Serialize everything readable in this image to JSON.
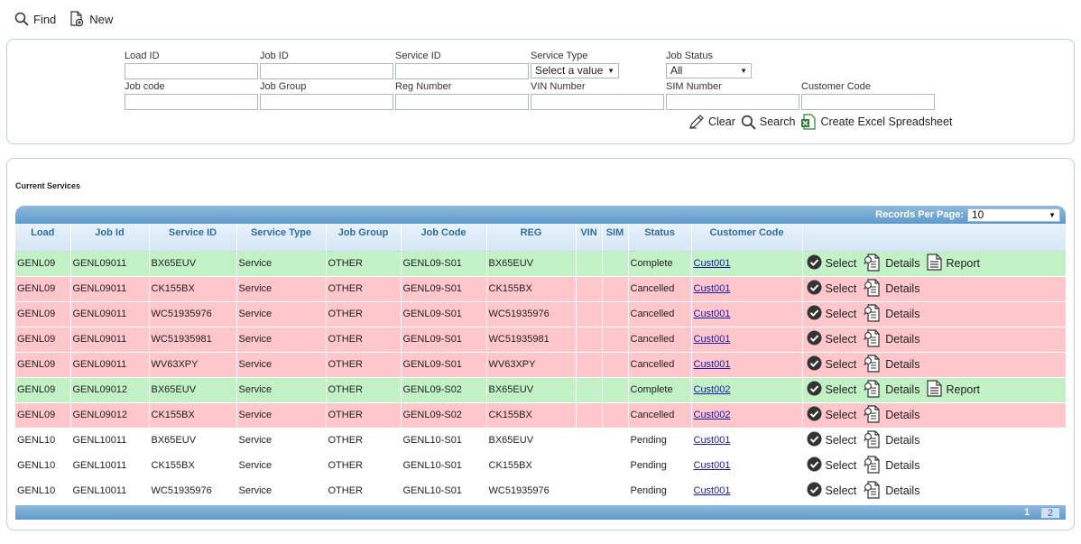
{
  "toolbar": {
    "find_label": "Find",
    "new_label": "New"
  },
  "search": {
    "fields": {
      "load_id": {
        "label": "Load ID",
        "value": ""
      },
      "job_id": {
        "label": "Job ID",
        "value": ""
      },
      "service_id": {
        "label": "Service ID",
        "value": ""
      },
      "service_type": {
        "label": "Service Type",
        "value": "Select a value"
      },
      "job_status": {
        "label": "Job Status",
        "value": "All"
      },
      "job_code": {
        "label": "Job code",
        "value": ""
      },
      "job_group": {
        "label": "Job Group",
        "value": ""
      },
      "reg_number": {
        "label": "Reg Number",
        "value": ""
      },
      "vin_number": {
        "label": "VIN Number",
        "value": ""
      },
      "sim_number": {
        "label": "SIM Number",
        "value": ""
      },
      "customer_code": {
        "label": "Customer Code",
        "value": ""
      }
    },
    "actions": {
      "clear": "Clear",
      "search": "Search",
      "excel": "Create Excel Spreadsheet"
    }
  },
  "results": {
    "title": "Current Services",
    "records_per_page_label": "Records Per Page:",
    "records_per_page_value": "10",
    "columns": [
      "Load",
      "Job Id",
      "Service ID",
      "Service Type",
      "Job Group",
      "Job Code",
      "REG",
      "VIN",
      "SIM",
      "Status",
      "Customer Code"
    ],
    "row_actions": {
      "select": "Select",
      "details": "Details",
      "report": "Report"
    },
    "rows": [
      {
        "load": "GENL09",
        "job_id": "GENL09011",
        "service_id": "BX65EUV",
        "service_type": "Service",
        "job_group": "OTHER",
        "job_code": "GENL09-S01",
        "reg": "BX65EUV",
        "vin": "",
        "sim": "",
        "status": "Complete",
        "customer_code": "Cust001"
      },
      {
        "load": "GENL09",
        "job_id": "GENL09011",
        "service_id": "CK155BX",
        "service_type": "Service",
        "job_group": "OTHER",
        "job_code": "GENL09-S01",
        "reg": "CK155BX",
        "vin": "",
        "sim": "",
        "status": "Cancelled",
        "customer_code": "Cust001"
      },
      {
        "load": "GENL09",
        "job_id": "GENL09011",
        "service_id": "WC51935976",
        "service_type": "Service",
        "job_group": "OTHER",
        "job_code": "GENL09-S01",
        "reg": "WC51935976",
        "vin": "",
        "sim": "",
        "status": "Cancelled",
        "customer_code": "Cust001"
      },
      {
        "load": "GENL09",
        "job_id": "GENL09011",
        "service_id": "WC51935981",
        "service_type": "Service",
        "job_group": "OTHER",
        "job_code": "GENL09-S01",
        "reg": "WC51935981",
        "vin": "",
        "sim": "",
        "status": "Cancelled",
        "customer_code": "Cust001"
      },
      {
        "load": "GENL09",
        "job_id": "GENL09011",
        "service_id": "WV63XPY",
        "service_type": "Service",
        "job_group": "OTHER",
        "job_code": "GENL09-S01",
        "reg": "WV63XPY",
        "vin": "",
        "sim": "",
        "status": "Cancelled",
        "customer_code": "Cust001"
      },
      {
        "load": "GENL09",
        "job_id": "GENL09012",
        "service_id": "BX65EUV",
        "service_type": "Service",
        "job_group": "OTHER",
        "job_code": "GENL09-S02",
        "reg": "BX65EUV",
        "vin": "",
        "sim": "",
        "status": "Complete",
        "customer_code": "Cust002"
      },
      {
        "load": "GENL09",
        "job_id": "GENL09012",
        "service_id": "CK155BX",
        "service_type": "Service",
        "job_group": "OTHER",
        "job_code": "GENL09-S02",
        "reg": "CK155BX",
        "vin": "",
        "sim": "",
        "status": "Cancelled",
        "customer_code": "Cust002"
      },
      {
        "load": "GENL10",
        "job_id": "GENL10011",
        "service_id": "BX65EUV",
        "service_type": "Service",
        "job_group": "OTHER",
        "job_code": "GENL10-S01",
        "reg": "BX65EUV",
        "vin": "",
        "sim": "",
        "status": "Pending",
        "customer_code": "Cust001"
      },
      {
        "load": "GENL10",
        "job_id": "GENL10011",
        "service_id": "CK155BX",
        "service_type": "Service",
        "job_group": "OTHER",
        "job_code": "GENL10-S01",
        "reg": "CK155BX",
        "vin": "",
        "sim": "",
        "status": "Pending",
        "customer_code": "Cust001"
      },
      {
        "load": "GENL10",
        "job_id": "GENL10011",
        "service_id": "WC51935976",
        "service_type": "Service",
        "job_group": "OTHER",
        "job_code": "GENL10-S01",
        "reg": "WC51935976",
        "vin": "",
        "sim": "",
        "status": "Pending",
        "customer_code": "Cust001"
      }
    ],
    "pagination": {
      "current": "1",
      "pages": [
        "1",
        "2"
      ]
    }
  },
  "colors": {
    "complete": "#c3f1c6",
    "cancelled": "#ffc6cc",
    "header_link": "#2f6ea3",
    "bar": "#5e9acc"
  },
  "icons": {
    "find": "magnifier-icon",
    "new": "new-document-icon",
    "clear": "pencil-icon",
    "search": "magnifier-icon",
    "excel": "excel-icon",
    "select": "check-circle-icon",
    "details": "details-document-icon",
    "report": "report-document-icon"
  }
}
